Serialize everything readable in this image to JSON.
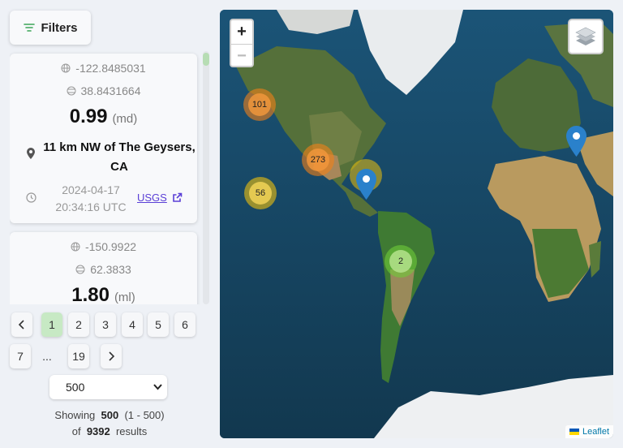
{
  "filters": {
    "label": "Filters"
  },
  "events": [
    {
      "longitude": "-122.8485031",
      "latitude": "38.8431664",
      "magnitude": "0.99",
      "mag_type": "(md)",
      "place": "11 km NW of The Geysers, CA",
      "date": "2024-04-17",
      "time": "20:34:16 UTC",
      "source": "USGS"
    },
    {
      "longitude": "-150.9922",
      "latitude": "62.3833",
      "magnitude": "1.80",
      "mag_type": "(ml)"
    }
  ],
  "pagination": {
    "pages": [
      "1",
      "2",
      "3",
      "4",
      "5",
      "6",
      "7",
      "19"
    ],
    "ellipsis": "...",
    "current": "1"
  },
  "page_size": {
    "selected": "500"
  },
  "summary": {
    "prefix": "Showing",
    "count": "500",
    "range": "(1 - 500)",
    "of_label": "of",
    "total": "9392",
    "suffix": "results"
  },
  "map": {
    "zoom_in": "+",
    "zoom_out": "−",
    "clusters": [
      {
        "count": "101",
        "color": "orange"
      },
      {
        "count": "273",
        "color": "orange"
      },
      {
        "count": "56",
        "color": "yellow"
      },
      {
        "count": "2",
        "color": "green"
      }
    ],
    "attribution": "Leaflet"
  },
  "colors": {
    "accent": "#5a3fd6",
    "active_page": "#c7e9c4",
    "marker": "#2a81cb"
  }
}
